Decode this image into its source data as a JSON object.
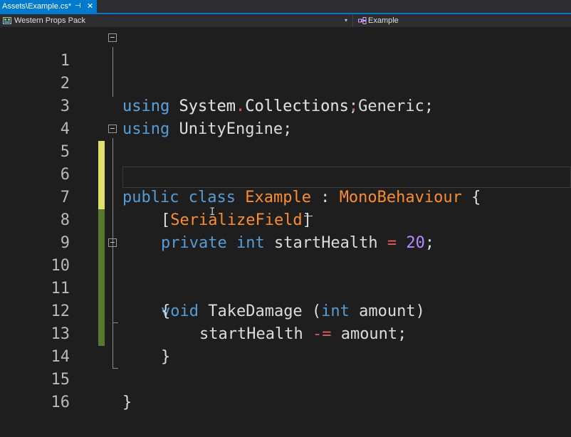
{
  "tab": {
    "title": "Assets\\Example.cs*",
    "pin_glyph": "⊣",
    "close_glyph": "✕"
  },
  "navbar": {
    "project": "Western Props Pack",
    "class_name": "Example",
    "dropdown_glyph": "▾"
  },
  "editor": {
    "line_numbers": [
      "1",
      "2",
      "3",
      "4",
      "5",
      "6",
      "7",
      "8",
      "9",
      "10",
      "11",
      "12",
      "13",
      "14",
      "15",
      "16"
    ],
    "code": {
      "l1": [
        "using",
        " System",
        ".",
        "Collections;"
      ],
      "l2": [
        "using",
        " System",
        ".",
        "Collections",
        ".",
        "Generic;"
      ],
      "l3": [
        "using",
        " UnityEngine;"
      ],
      "l5": [
        "public",
        " ",
        "class",
        " ",
        "Example",
        " : ",
        "MonoBehaviour",
        " {"
      ],
      "l7": [
        "[",
        "SerializeField",
        "]"
      ],
      "l8": [
        "private",
        " ",
        "int",
        " startHealth ",
        "=",
        " ",
        "20",
        ";"
      ],
      "l10": [
        "void",
        " TakeDamage (",
        "int",
        " amount)"
      ],
      "l11": "{",
      "l12": [
        "startHealth ",
        "-=",
        " amount;"
      ],
      "l13": "}",
      "l15": "}"
    }
  },
  "colors": {
    "background": "#1e1e1e",
    "keyword": "#569cd6",
    "type": "#fb8d2f",
    "number": "#b38aff",
    "operator": "#e05a5a",
    "accent": "#007acc",
    "change_saved": "#57792a",
    "change_unsaved": "#e1e06a"
  }
}
